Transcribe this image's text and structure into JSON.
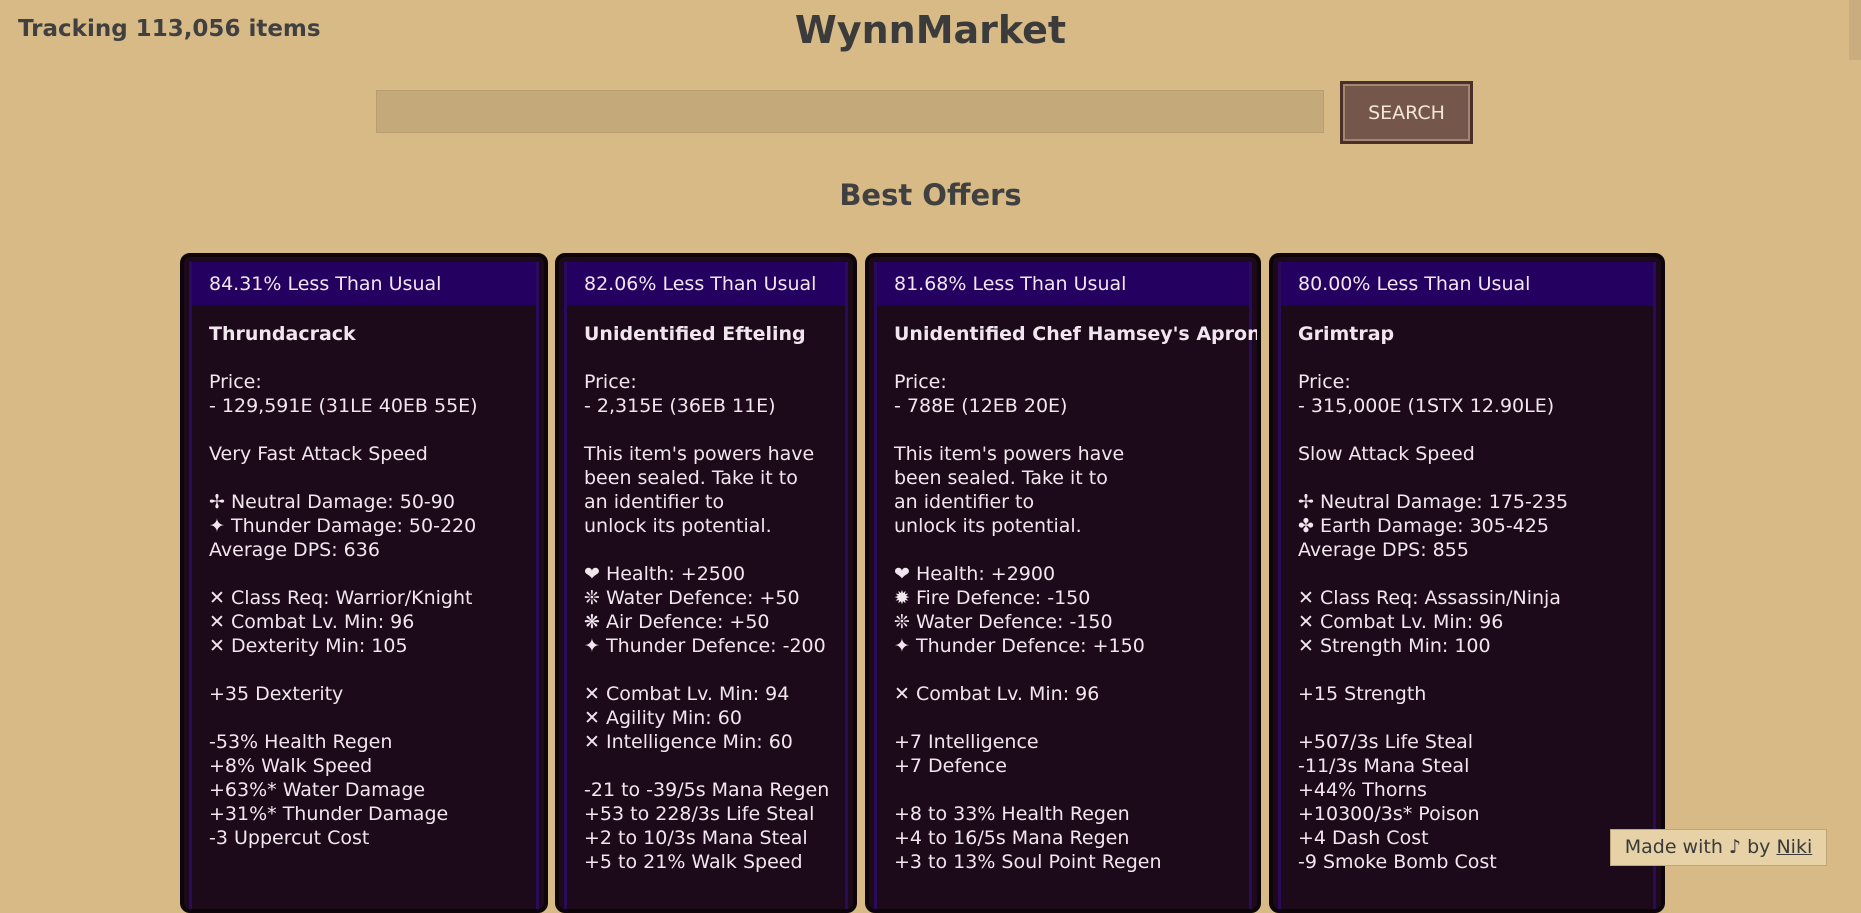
{
  "header": {
    "tracking": "Tracking 113,056 items",
    "title": "WynnMarket"
  },
  "search": {
    "placeholder": "",
    "button_label": "SEARCH"
  },
  "section_title": "Best Offers",
  "cards": [
    {
      "badge": "84.31% Less Than Usual",
      "name": "Thrundacrack",
      "body": "\nPrice:\n- 129,591E (31LE 40EB 55E)\n\nVery Fast Attack Speed\n\n✢ Neutral Damage: 50-90\n✦ Thunder Damage: 50-220\nAverage DPS: 636\n\n✕ Class Req: Warrior/Knight\n✕ Combat Lv. Min: 96\n✕ Dexterity Min: 105\n\n+35 Dexterity\n\n-53% Health Regen\n+8% Walk Speed\n+63%* Water Damage\n+31%* Thunder Damage\n-3 Uppercut Cost"
    },
    {
      "badge": "82.06% Less Than Usual",
      "name": "Unidentified Efteling",
      "body": "\nPrice:\n- 2,315E (36EB 11E)\n\nThis item's powers have\nbeen sealed. Take it to\nan identifier to\nunlock its potential.\n\n❤ Health: +2500\n❊ Water Defence: +50\n❋ Air Defence: +50\n✦ Thunder Defence: -200\n\n✕ Combat Lv. Min: 94\n✕ Agility Min: 60\n✕ Intelligence Min: 60\n\n-21 to -39/5s Mana Regen\n+53 to 228/3s Life Steal\n+2 to 10/3s Mana Steal\n+5 to 21% Walk Speed"
    },
    {
      "badge": "81.68% Less Than Usual",
      "name": "Unidentified Chef Hamsey's Apron",
      "body": "\nPrice:\n- 788E (12EB 20E)\n\nThis item's powers have\nbeen sealed. Take it to\nan identifier to\nunlock its potential.\n\n❤ Health: +2900\n✹ Fire Defence: -150\n❊ Water Defence: -150\n✦ Thunder Defence: +150\n\n✕ Combat Lv. Min: 96\n\n+7 Intelligence\n+7 Defence\n\n+8 to 33% Health Regen\n+4 to 16/5s Mana Regen\n+3 to 13% Soul Point Regen"
    },
    {
      "badge": "80.00% Less Than Usual",
      "name": "Grimtrap",
      "body": "\nPrice:\n- 315,000E (1STX 12.90LE)\n\nSlow Attack Speed\n\n✢ Neutral Damage: 175-235\n✤ Earth Damage: 305-425\nAverage DPS: 855\n\n✕ Class Req: Assassin/Ninja\n✕ Combat Lv. Min: 96\n✕ Strength Min: 100\n\n+15 Strength\n\n+507/3s Life Steal\n-11/3s Mana Steal\n+44% Thorns\n+10300/3s* Poison\n+4 Dash Cost\n-9 Smoke Bomb Cost"
    }
  ],
  "footer": {
    "made_with": "Made with",
    "note_icon": "♪",
    "by": "by",
    "author": "Niki"
  },
  "colors": {
    "background": "#d8ba87",
    "card_background": "#1c0a1a",
    "card_header": "#240060",
    "button": "#75564a"
  }
}
